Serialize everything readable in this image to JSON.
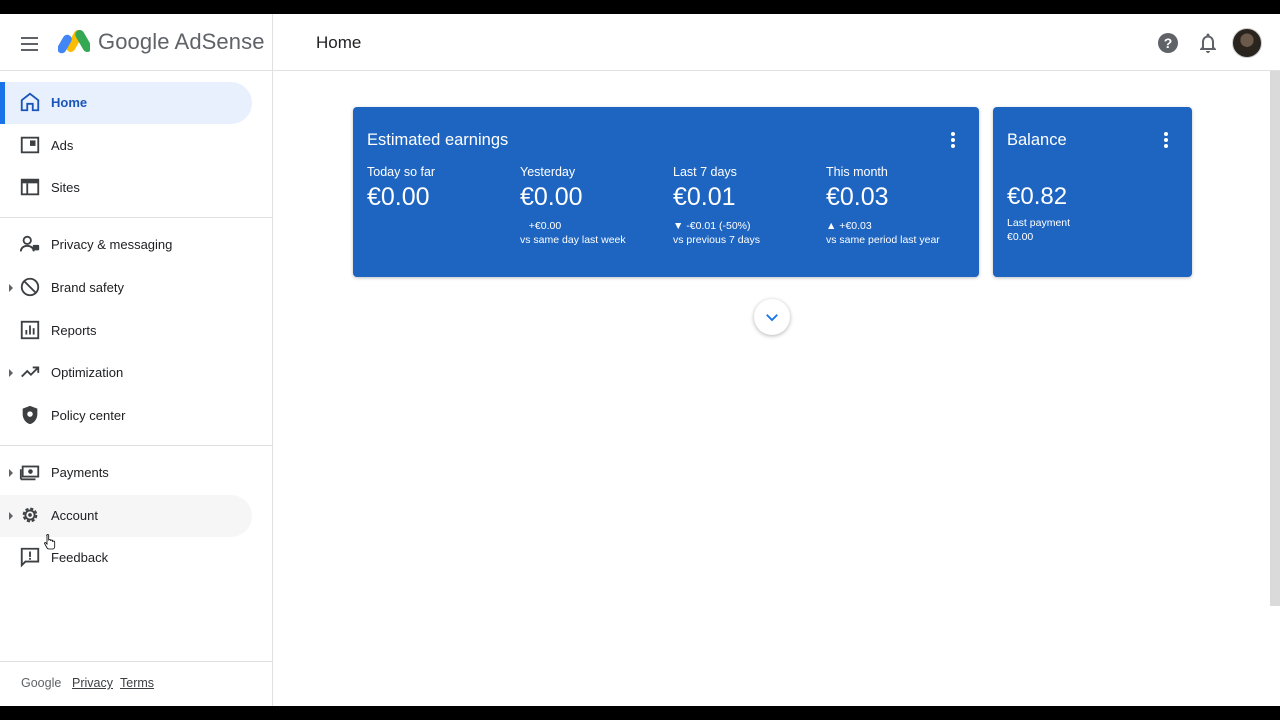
{
  "header": {
    "brand": "Google AdSense",
    "page_title": "Home",
    "icons": [
      "menu-icon",
      "adsense-logo",
      "help-icon",
      "bell-icon",
      "avatar"
    ]
  },
  "sidebar": {
    "items": [
      {
        "label": "Home",
        "icon": "home-icon",
        "active": true
      },
      {
        "label": "Ads",
        "icon": "ads-icon"
      },
      {
        "label": "Sites",
        "icon": "sites-icon"
      },
      {
        "label": "Privacy & messaging",
        "icon": "privacy-icon"
      },
      {
        "label": "Brand safety",
        "icon": "block-icon",
        "expandable": true
      },
      {
        "label": "Reports",
        "icon": "reports-icon"
      },
      {
        "label": "Optimization",
        "icon": "trending-up-icon",
        "expandable": true
      },
      {
        "label": "Policy center",
        "icon": "shield-icon"
      },
      {
        "label": "Payments",
        "icon": "payments-icon",
        "expandable": true
      },
      {
        "label": "Account",
        "icon": "gear-icon",
        "expandable": true,
        "hover": true
      },
      {
        "label": "Feedback",
        "icon": "feedback-icon"
      }
    ],
    "footer": {
      "google": "Google",
      "privacy": "Privacy",
      "terms": "Terms"
    }
  },
  "earnings": {
    "title": "Estimated earnings",
    "metrics": [
      {
        "label": "Today so far",
        "value": "€0.00",
        "change": "",
        "compare": ""
      },
      {
        "label": "Yesterday",
        "value": "€0.00",
        "change": "   +€0.00",
        "compare": "vs same day last week"
      },
      {
        "label": "Last 7 days",
        "value": "€0.01",
        "change": "▼ -€0.01 (-50%)",
        "compare": "vs previous 7 days"
      },
      {
        "label": "This month",
        "value": "€0.03",
        "change": "▲ +€0.03",
        "compare": "vs same period last year"
      }
    ]
  },
  "balance": {
    "title": "Balance",
    "value": "€0.82",
    "last_payment_label": "Last payment",
    "last_payment_value": "€0.00"
  },
  "colors": {
    "card_blue": "#1e65c1",
    "active_bg": "#e8f0fe",
    "active_text": "#1a56b8",
    "accent": "#1a73e8"
  }
}
